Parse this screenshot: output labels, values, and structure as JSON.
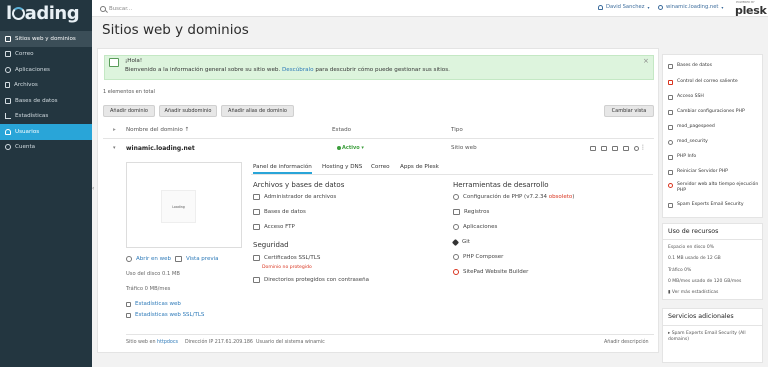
{
  "sidebar": {
    "logo": "loading",
    "items": [
      {
        "label": "Sitios web y dominios",
        "icon": "monitor-icon"
      },
      {
        "label": "Correo",
        "icon": "mail-icon"
      },
      {
        "label": "Aplicaciones",
        "icon": "apps-icon"
      },
      {
        "label": "Archivos",
        "icon": "folder-icon"
      },
      {
        "label": "Bases de datos",
        "icon": "database-icon"
      },
      {
        "label": "Estadísticas",
        "icon": "chart-icon"
      },
      {
        "label": "Usuarios",
        "icon": "user-icon"
      },
      {
        "label": "Cuenta",
        "icon": "account-icon"
      }
    ],
    "collapse_glyph": "‹"
  },
  "topbar": {
    "search_placeholder": "Buscar...",
    "user": "David Sanchez",
    "domain": "winamic.loading.net",
    "powered_by": "POWERED BY",
    "brand": "plesk"
  },
  "page": {
    "title": "Sitios web y dominios"
  },
  "banner": {
    "hello": "¡Hola!",
    "text": "Bienvenido a la información general sobre su sitio web.",
    "link": "Descúbralo",
    "text2": "para descubrir cómo puede gestionar sus sitios.",
    "close": "×"
  },
  "list": {
    "count": "1 elementos en total",
    "buttons": {
      "add_domain": "Añadir dominio",
      "add_subdomain": "Añadir subdominio",
      "add_alias": "Añadir alias de dominio",
      "change_view": "Cambiar vista"
    },
    "columns": {
      "name": "Nombre del dominio ↑",
      "status": "Estado",
      "type": "Tipo"
    },
    "domain": {
      "name": "winamic.loading.net",
      "status": "Activo ▾",
      "type": "Sitio web",
      "more": "⋮"
    }
  },
  "site": {
    "preview_text": "Loading",
    "open_web": "Abrir en web",
    "preview": "Vista previa",
    "disk_usage": "Uso del disco 0.1 MB",
    "traffic": "Tráfico 0 MB/mes",
    "stats_web": "Estadísticas web",
    "stats_ssl": "Estadísticas web SSL/TLS"
  },
  "tabs": [
    "Panel de información",
    "Hosting y DNS",
    "Correo",
    "Apps de Plesk"
  ],
  "files_section": {
    "title": "Archivos y bases de datos",
    "items": [
      "Administrador de archivos",
      "Bases de datos",
      "Acceso FTP"
    ]
  },
  "security_section": {
    "title": "Seguridad",
    "ssl": "Certificados SSL/TLS",
    "ssl_status": "Dominio no protegido",
    "protected_dirs": "Directorios protegidos con contraseña"
  },
  "dev_section": {
    "title": "Herramientas de desarrollo",
    "php": "Configuración de PHP (v7.2.34",
    "php_status": "obsoleto",
    "php_end": ")",
    "items": [
      "Registros",
      "Aplicaciones",
      "Git",
      "PHP Composer",
      "SitePad Website Builder"
    ]
  },
  "footer": {
    "web_in": "Sitio web en",
    "httpdocs": "httpdocs",
    "ip": "Dirección IP 217.61.209.186",
    "sys_user": "Usuario del sistema winamic",
    "add_description": "Añadir descripción"
  },
  "rail": {
    "links": [
      "Bases de datos",
      "Control del correo saliente",
      "Acceso SSH",
      "Cambiar configuraciones PHP",
      "mod_pagespeed",
      "mod_security",
      "PHP Info",
      "Reiniciar Servidor PHP",
      "Servidor web alto tiempo ejecución PHP",
      "Spam Experts Email Security"
    ],
    "resources": {
      "title": "Uso de recursos",
      "disk_label": "Espacio en disco 0%",
      "disk_value": "0.1 MB usado de 12 GB",
      "traffic_label": "Tráfico 0%",
      "traffic_value": "0 MB/mes usado de 120 GB/mes",
      "more": "Ver más estadísticas"
    },
    "services": {
      "title": "Servicios adicionales",
      "item": "Spam Experts Email Security (All domains)"
    }
  },
  "colors": {
    "sidebar": "#233640",
    "accent": "#29a5d8",
    "banner": "#ddf4dd",
    "active_green": "#3c9e3c",
    "warn_red": "#d9341f"
  }
}
